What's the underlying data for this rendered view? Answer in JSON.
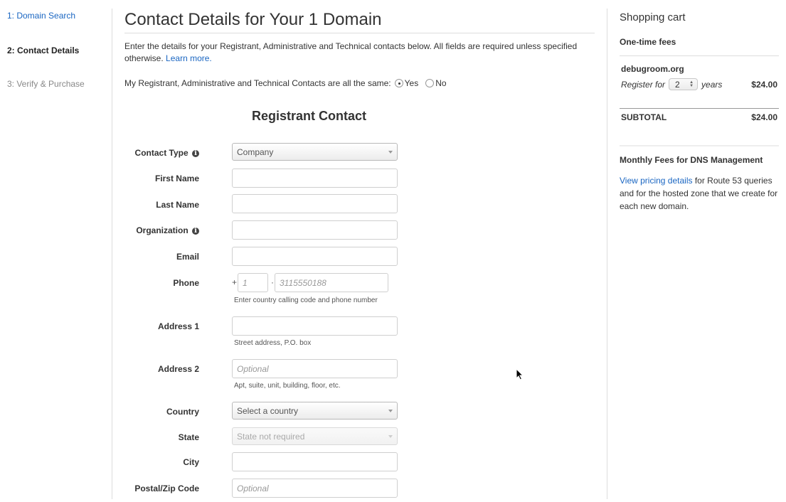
{
  "steps": [
    {
      "label": "1: Domain Search",
      "state": "link"
    },
    {
      "label": "2: Contact Details",
      "state": "current"
    },
    {
      "label": "3: Verify & Purchase",
      "state": "disabled"
    }
  ],
  "main": {
    "title": "Contact Details for Your 1 Domain",
    "intro_text": "Enter the details for your Registrant, Administrative and Technical contacts below. All fields are required unless specified otherwise.",
    "learn_more": "Learn more.",
    "same_contacts_label": "My Registrant, Administrative and Technical Contacts are all the same:",
    "same_yes": "Yes",
    "same_no": "No",
    "same_selected": "Yes",
    "section_title": "Registrant Contact",
    "fields": {
      "contact_type": {
        "label": "Contact Type",
        "value": "Company",
        "info_icon": "info-icon"
      },
      "first_name": {
        "label": "First Name",
        "value": "",
        "placeholder": ""
      },
      "last_name": {
        "label": "Last Name",
        "value": "",
        "placeholder": ""
      },
      "organization": {
        "label": "Organization",
        "value": "",
        "placeholder": "",
        "info_icon": "info-icon"
      },
      "email": {
        "label": "Email",
        "value": "",
        "placeholder": ""
      },
      "phone": {
        "label": "Phone",
        "plus": "+",
        "separator": "·",
        "country_code_placeholder": "1",
        "number_placeholder": "3115550188",
        "help": "Enter country calling code and phone number"
      },
      "address1": {
        "label": "Address 1",
        "value": "",
        "placeholder": "",
        "help": "Street address, P.O. box"
      },
      "address2": {
        "label": "Address 2",
        "value": "",
        "placeholder": "Optional",
        "help": "Apt, suite, unit, building, floor, etc."
      },
      "country": {
        "label": "Country",
        "value": "Select a country"
      },
      "state": {
        "label": "State",
        "value": "State not required",
        "disabled": true
      },
      "city": {
        "label": "City",
        "value": "",
        "placeholder": ""
      },
      "postal": {
        "label": "Postal/Zip Code",
        "value": "",
        "placeholder": "Optional"
      }
    }
  },
  "cart": {
    "title": "Shopping cart",
    "one_time_fees": "One-time fees",
    "domain": "debugroom.org",
    "register_for": "Register for",
    "years_value": "2",
    "years_label": "years",
    "domain_price": "$24.00",
    "subtotal_label": "SUBTOTAL",
    "subtotal_value": "$24.00",
    "dns_title": "Monthly Fees for DNS Management",
    "dns_link": "View pricing details",
    "dns_text": " for Route 53 queries and for the hosted zone that we create for each new domain."
  },
  "colors": {
    "link": "#1a66c2",
    "text": "#333333",
    "muted": "#888888"
  }
}
